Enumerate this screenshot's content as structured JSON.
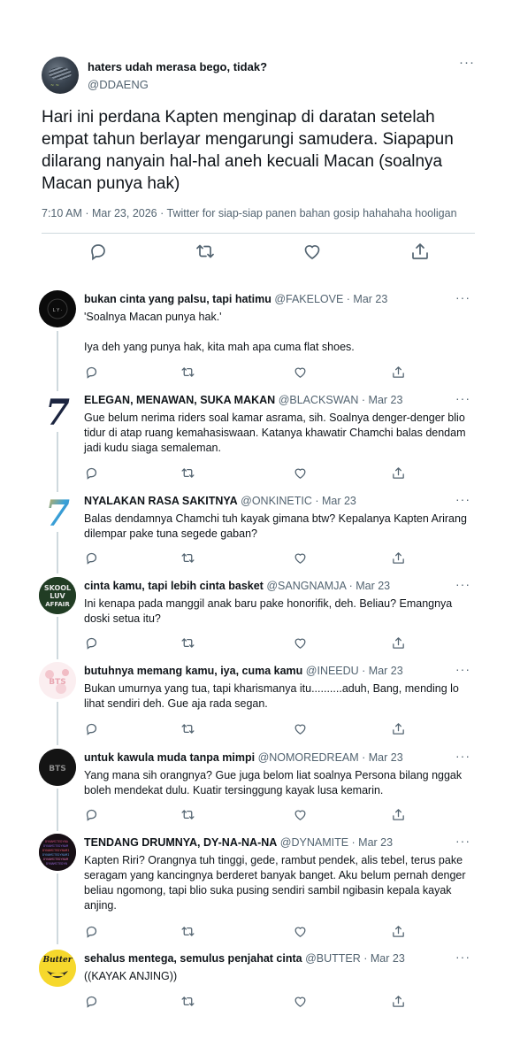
{
  "main_tweet": {
    "display_name": "haters udah merasa bego, tidak?",
    "handle": "@DDAENG",
    "text": "Hari ini perdana Kapten menginap di daratan setelah empat tahun berlayar mengarungi samudera. Siapapun dilarang nanyain hal-hal aneh kecuali Macan (soalnya Macan punya hak)",
    "meta": "7:10 AM · Mar 23, 2026 · Twitter for siap-siap panen bahan gosip hahahaha hooligan",
    "more": "···"
  },
  "replies": [
    {
      "display_name": "bukan cinta yang palsu, tapi hatimu",
      "handle": "@FAKELOVE · Mar 23",
      "text": "'Soalnya Macan punya hak.'\n\nIya deh yang punya hak, kita mah apa cuma flat shoes.",
      "avatar": "fakelove",
      "more": "···"
    },
    {
      "display_name": "ELEGAN, MENAWAN, SUKA MAKAN",
      "handle": "@BLACKSWAN · Mar 23",
      "text": "Gue belum nerima riders soal kamar asrama, sih. Soalnya denger-denger blio tidur di atap ruang kemahasiswaan. Katanya khawatir Chamchi balas dendam jadi kudu siaga semaleman.",
      "avatar": "seven-dark",
      "more": "···"
    },
    {
      "display_name": "NYALAKAN RASA SAKITNYA",
      "handle": "@ONKINETIC · Mar 23",
      "text": "Balas dendamnya Chamchi tuh kayak gimana btw? Kepalanya Kapten Arirang dilempar pake tuna segede gaban?",
      "avatar": "seven-color",
      "more": "···"
    },
    {
      "display_name": "cinta kamu, tapi lebih cinta basket",
      "handle": "@SANGNAMJA · Mar 23",
      "text": "Ini kenapa pada manggil anak baru pake honorifik, deh. Beliau? Emangnya doski setua itu?",
      "avatar": "skool",
      "avatar_text": "SKOOL LUV AFFAIR",
      "more": "···"
    },
    {
      "display_name": "butuhnya memang kamu, iya, cuma kamu",
      "handle": "@INEEDU · Mar 23",
      "text": "Bukan umurnya yang tua, tapi kharismanya itu..........aduh, Bang, mending lo lihat sendiri deh. Gue aja rada segan.",
      "avatar": "pink",
      "avatar_text": "BTS",
      "more": "···"
    },
    {
      "display_name": "untuk kawula muda tanpa mimpi",
      "handle": "@NOMOREDREAM · Mar 23",
      "text": "Yang mana sih orangnya? Gue juga belom liat soalnya Persona bilang nggak boleh mendekat dulu. Kuatir tersinggung kayak lusa kemarin.",
      "avatar": "bts-dark",
      "avatar_text": "BTS",
      "more": "···"
    },
    {
      "display_name": "TENDANG DRUMNYA, DY-NA-NA-NA",
      "handle": "@DYNAMITE · Mar 23",
      "text": "Kapten Riri? Orangnya tuh tinggi, gede, rambut pendek, alis tebel, terus pake seragam yang kancingnya berderet banyak banget. Aku belum pernah denger beliau ngomong, tapi blio suka pusing sendiri sambil ngibasin kepala kayak anjing.",
      "avatar": "dynamite",
      "more": "···"
    },
    {
      "display_name": "sehalus mentega, semulus penjahat cinta",
      "handle": "@BUTTER · Mar 23",
      "text": "((KAYAK ANJING))",
      "avatar": "butter",
      "avatar_text": "Butter",
      "more": "···"
    }
  ],
  "actions": [
    "reply-icon",
    "retweet-icon",
    "like-icon",
    "share-icon"
  ],
  "colors": {
    "text": "#0f1419",
    "secondary": "#536471",
    "divider": "#cfd9de"
  }
}
